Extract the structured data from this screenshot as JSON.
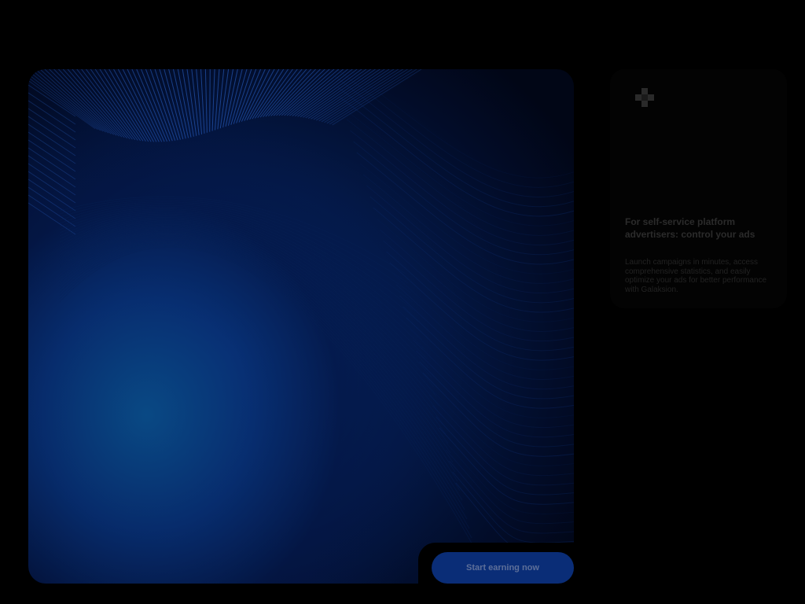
{
  "hero": {
    "colors": {
      "glow": "#0a5a8c",
      "deep": "#062a6a",
      "lines": "#1a4ea8"
    }
  },
  "cta": {
    "label": "Start earning now",
    "color": "#0a2d77"
  },
  "card": {
    "icon": "diamond-grid-icon",
    "title": "For self-service platform advertisers: control your ads",
    "description": "Launch campaigns in minutes, access comprehensive statistics, and easily optimize your ads for better performance with Galaksion."
  }
}
